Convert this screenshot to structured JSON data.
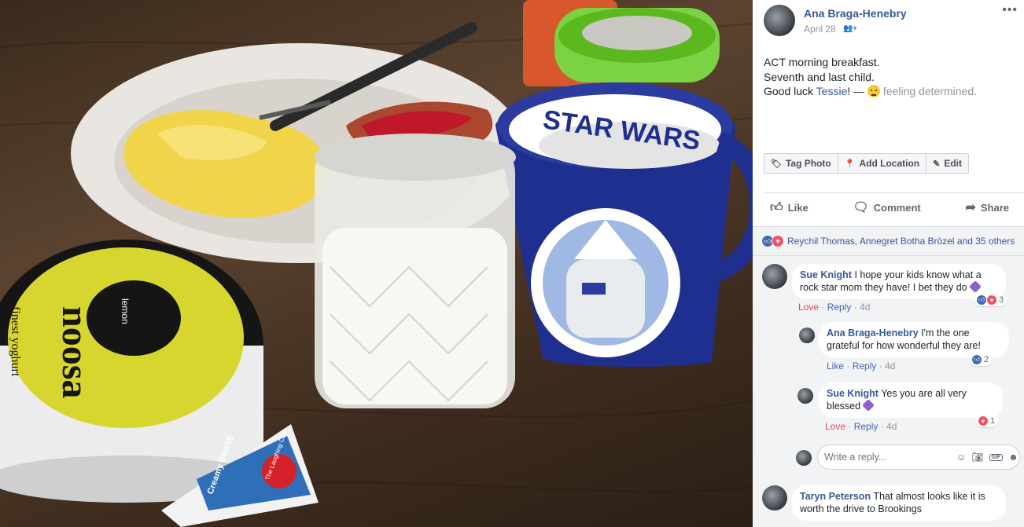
{
  "post": {
    "author": "Ana Braga-Henebry",
    "date": "April 28",
    "privacy_icon": "friends-icon",
    "more_icon": "ellipsis-icon",
    "caption_line1": "ACT morning breakfast.",
    "caption_line2": "Seventh and last child.",
    "caption_line3_prefix": "Good luck ",
    "caption_tag": "Tessie",
    "caption_line3_suffix": "! — ",
    "feeling": "feeling determined."
  },
  "photo_actions": [
    {
      "label": "Tag Photo",
      "icon": "tag-icon"
    },
    {
      "label": "Add Location",
      "icon": "location-pin-icon"
    },
    {
      "label": "Edit",
      "icon": "pencil-icon"
    }
  ],
  "actions": {
    "like": "Like",
    "comment": "Comment",
    "share": "Share"
  },
  "reactions": {
    "summary": "Reychil Thomas, Annegret Botha Brözel and 35 others",
    "like_color": "#4267b2",
    "love_color": "#f25268"
  },
  "comments": [
    {
      "name": "Sue Knight",
      "text_line1": "I hope your kids know what a",
      "text_line2": "rock star mom they have! I bet they do",
      "reaction_label": "Love",
      "reply_label": "Reply",
      "time": "4d",
      "count": "3"
    },
    {
      "name": "Ana Braga-Henebry",
      "text_line1": "I'm the one",
      "text_line2": "grateful for how wonderful they are!",
      "reaction_label": "Like",
      "reply_label": "Reply",
      "time": "4d",
      "count": "2"
    },
    {
      "name": "Sue Knight",
      "text_line1": "Yes you are all very",
      "text_line2": "blessed",
      "reaction_label": "Love",
      "reply_label": "Reply",
      "time": "4d",
      "count": "1"
    },
    {
      "name": "Taryn Peterson",
      "text_line1": "That almost looks like it is",
      "text_line2": "worth the drive to Brookings"
    }
  ],
  "reply_box": {
    "placeholder": "Write a reply...",
    "icons": [
      "emoji-icon",
      "camera-icon",
      "gif-icon",
      "sticker-icon"
    ]
  },
  "photo": {
    "mug_text": "STAR WARS",
    "yogurt_brand": "noosa",
    "yogurt_sub": "finest yoghurt",
    "yogurt_flavor": "lemon",
    "cheese_text": "Creamy SWISS",
    "cheese_brand": "The Laughing Cow"
  }
}
